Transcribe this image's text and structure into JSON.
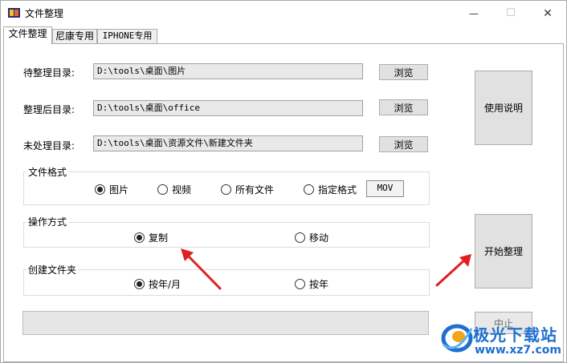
{
  "window": {
    "title": "文件整理",
    "controls": {
      "minimize": "—",
      "maximize": "☐",
      "close": "✕"
    }
  },
  "tabs": [
    {
      "label": "文件整理",
      "active": true
    },
    {
      "label": "尼康专用",
      "active": false
    },
    {
      "label": "IPHONE专用",
      "active": false
    }
  ],
  "directories": [
    {
      "label": "待整理目录:",
      "value": "D:\\tools\\桌面\\图片",
      "browse": "浏览"
    },
    {
      "label": "整理后目录:",
      "value": "D:\\tools\\桌面\\office",
      "browse": "浏览"
    },
    {
      "label": "未处理目录:",
      "value": "D:\\tools\\桌面\\资源文件\\新建文件夹",
      "browse": "浏览"
    }
  ],
  "file_format": {
    "title": "文件格式",
    "options": [
      {
        "label": "图片",
        "selected": true
      },
      {
        "label": "视频",
        "selected": false
      },
      {
        "label": "所有文件",
        "selected": false
      },
      {
        "label": "指定格式",
        "selected": false
      }
    ],
    "custom_format": "MOV"
  },
  "operation": {
    "title": "操作方式",
    "options": [
      {
        "label": "复制",
        "selected": true
      },
      {
        "label": "移动",
        "selected": false
      }
    ]
  },
  "create_folder": {
    "title": "创建文件夹",
    "options": [
      {
        "label": "按年/月",
        "selected": true
      },
      {
        "label": "按年",
        "selected": false
      }
    ]
  },
  "buttons": {
    "instructions": "使用说明",
    "start": "开始整理",
    "stop": "中止"
  },
  "progress": 0,
  "watermark": {
    "text": "极光下载站",
    "url": "www.xz7.com"
  },
  "colors": {
    "arrow": "#e02020",
    "watermark": "#1e6fd0"
  }
}
